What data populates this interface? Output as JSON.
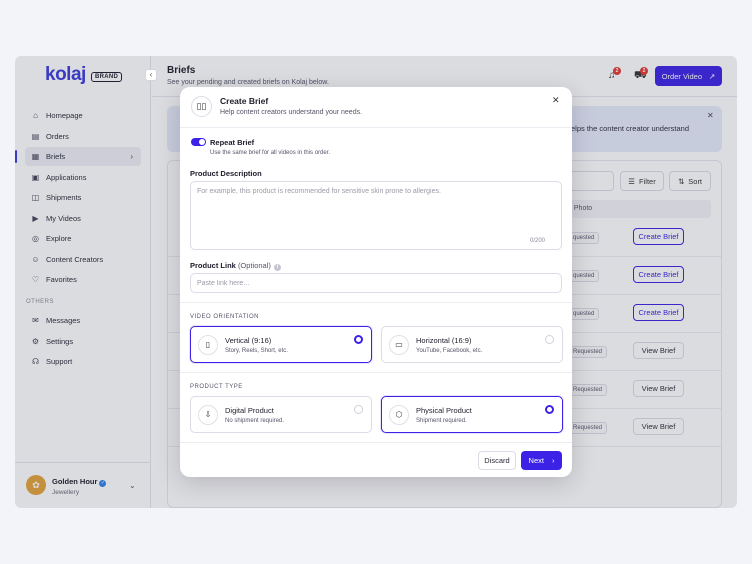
{
  "sidebar": {
    "logo": "kolaj",
    "logo_badge": "BRAND",
    "items": [
      {
        "label": "Homepage",
        "icon": "home-icon"
      },
      {
        "label": "Orders",
        "icon": "orders-icon"
      },
      {
        "label": "Briefs",
        "icon": "briefs-icon",
        "active": true
      },
      {
        "label": "Applications",
        "icon": "applications-icon"
      },
      {
        "label": "Shipments",
        "icon": "shipments-icon"
      },
      {
        "label": "My Videos",
        "icon": "video-icon"
      },
      {
        "label": "Explore",
        "icon": "compass-icon"
      },
      {
        "label": "Content Creators",
        "icon": "users-icon"
      },
      {
        "label": "Favorites",
        "icon": "heart-icon"
      }
    ],
    "others_title": "OTHERS",
    "others": [
      {
        "label": "Messages",
        "icon": "message-icon"
      },
      {
        "label": "Settings",
        "icon": "gear-icon"
      },
      {
        "label": "Support",
        "icon": "headset-icon"
      }
    ],
    "profile": {
      "name": "Golden Hour",
      "subtitle": "Jewellery"
    }
  },
  "header": {
    "title": "Briefs",
    "subtitle": "See your pending and created briefs on Kolaj below.",
    "notifications_count": "2",
    "cart_count": "2",
    "order_button": "Order Video"
  },
  "banner": {
    "text_fragment": "elps the content creator understand"
  },
  "toolbar": {
    "filter": "Filter",
    "sort": "Sort"
  },
  "table": {
    "column_fragment": "t Photo",
    "rows": [
      {
        "status": "quested",
        "action": "Create Brief",
        "primary": true
      },
      {
        "status": "quested",
        "action": "Create Brief",
        "primary": true
      },
      {
        "status": "quested",
        "action": "Create Brief",
        "primary": true
      },
      {
        "status": "Requested",
        "action": "View Brief",
        "primary": false
      },
      {
        "status": "Requested",
        "action": "View Brief",
        "primary": false
      },
      {
        "status": "Requested",
        "action": "View Brief",
        "primary": false
      }
    ]
  },
  "modal": {
    "title": "Create Brief",
    "subtitle": "Help content creators understand your needs.",
    "repeat_title": "Repeat Brief",
    "repeat_subtitle": "Use the same brief for all videos in this order.",
    "repeat_on": true,
    "description_label": "Product Description",
    "description_placeholder": "For example, this product is recommended for sensitive skin prone to allergies.",
    "description_counter": "0/200",
    "link_label": "Product Link",
    "link_optional": "(Optional)",
    "link_placeholder": "Paste link here...",
    "orientation_title": "VIDEO ORIENTATION",
    "orientation_options": [
      {
        "title": "Vertical (9:16)",
        "subtitle": "Story, Reels, Short, etc.",
        "selected": true
      },
      {
        "title": "Horizontal (16:9)",
        "subtitle": "YouTube, Facebook, etc.",
        "selected": false
      }
    ],
    "type_title": "PRODUCT TYPE",
    "type_options": [
      {
        "title": "Digital Product",
        "subtitle": "No shipment required.",
        "selected": false
      },
      {
        "title": "Physical Product",
        "subtitle": "Shipment required.",
        "selected": true
      }
    ],
    "discard": "Discard",
    "next": "Next"
  },
  "colors": {
    "accent": "#3b22e6",
    "brand": "#3b3bdb",
    "badge": "#e53935"
  }
}
